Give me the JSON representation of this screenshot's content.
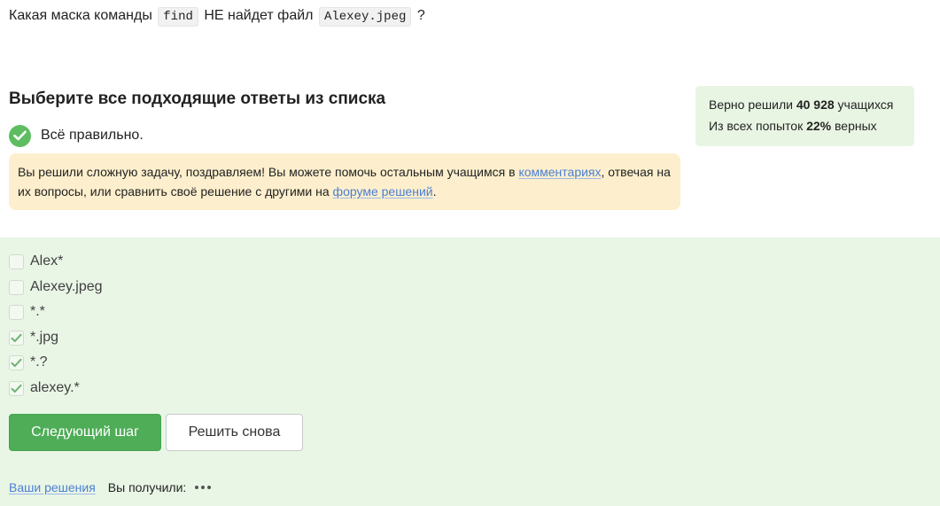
{
  "question": {
    "text_before": "Какая маска команды",
    "code1": "find",
    "text_middle": "НЕ найдет файл",
    "code2": "Alexey.jpeg",
    "text_after": "?"
  },
  "prompt_title": "Выберите все подходящие ответы из списка",
  "result": {
    "correct_text": "Всё правильно.",
    "icon": "checkmark-circle-icon",
    "color": "#5ebd61"
  },
  "notice": {
    "text1": "Вы решили сложную задачу, поздравляем! Вы можете помочь остальным учащимся в",
    "link1": "комментариях",
    "text2": ", отвечая на их вопросы, или сравнить своё решение с другими на",
    "link2": "форуме решений",
    "text3": ".",
    "background": "#fdefcd"
  },
  "stats": {
    "line1_prefix": "Верно решили",
    "solved_count": "40 928",
    "line1_suffix": "учащихся",
    "line2_prefix": "Из всех попыток",
    "percent": "22%",
    "line2_suffix": "верных"
  },
  "options": [
    {
      "label": "Alex*",
      "checked": false
    },
    {
      "label": "Alexey.jpeg",
      "checked": false
    },
    {
      "label": "*.*",
      "checked": false
    },
    {
      "label": "*.jpg",
      "checked": true
    },
    {
      "label": "*.?",
      "checked": true
    },
    {
      "label": "alexey.*",
      "checked": true
    }
  ],
  "buttons": {
    "next_label": "Следующий шаг",
    "retry_label": "Решить снова"
  },
  "footer": {
    "solutions_link": "Ваши решения",
    "received_label": "Вы получили:",
    "loading_icon": "more-dots-icon"
  },
  "colors": {
    "accent_green": "#4ead56",
    "answers_background": "#e9f6e6",
    "stats_background": "#e8f5e3",
    "link": "#4a7fd3"
  }
}
